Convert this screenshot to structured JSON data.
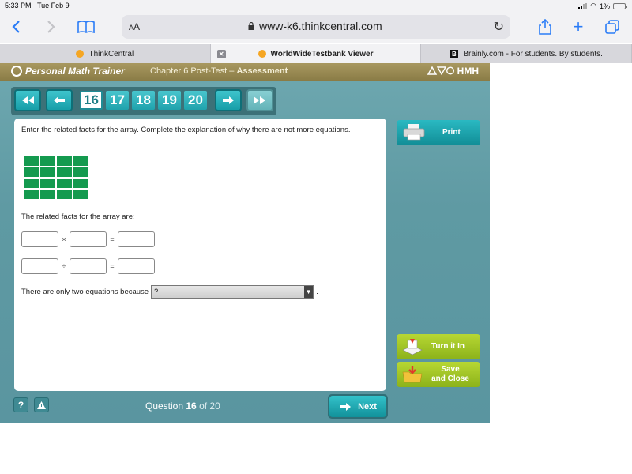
{
  "status_bar": {
    "time": "5:33 PM",
    "date": "Tue Feb 9",
    "battery": "1%"
  },
  "browser": {
    "aa_label_small": "A",
    "aa_label": "A",
    "url": "www-k6.thinkcentral.com",
    "tabs": [
      {
        "label": "ThinkCentral",
        "active": false
      },
      {
        "label": "WorldWideTestbank Viewer",
        "active": true
      },
      {
        "label": "Brainly.com - For students. By students.",
        "active": false
      }
    ]
  },
  "app": {
    "logo": "Personal Math Trainer",
    "chapter": "Chapter 6 Post-Test",
    "chapter_sep": " – ",
    "assessment": "Assessment",
    "brand": "HMH",
    "question_numbers": [
      "16",
      "17",
      "18",
      "19",
      "20"
    ],
    "current_question": "16"
  },
  "question": {
    "prompt": "Enter the related facts for the array. Complete the explanation of why there are not more equations.",
    "array_rows": 4,
    "array_cols": 4,
    "related_label": "The related facts for the array are:",
    "mult_op": "×",
    "div_op": "÷",
    "equals": "=",
    "because_text": "There are only two equations because",
    "select_value": "?",
    "period": "."
  },
  "buttons": {
    "print": "Print",
    "turn_in": "Turn it In",
    "save_line1": "Save",
    "save_line2": "and Close",
    "help": "?",
    "alert": "!",
    "next": "Next"
  },
  "footer": {
    "question_word": "Question",
    "current": "16",
    "of_text": "of 20"
  },
  "colors": {
    "teal": "#179ea8",
    "green_cell": "#149a4f",
    "lime": "#8cb21a",
    "header_gold": "#8a7c46"
  }
}
